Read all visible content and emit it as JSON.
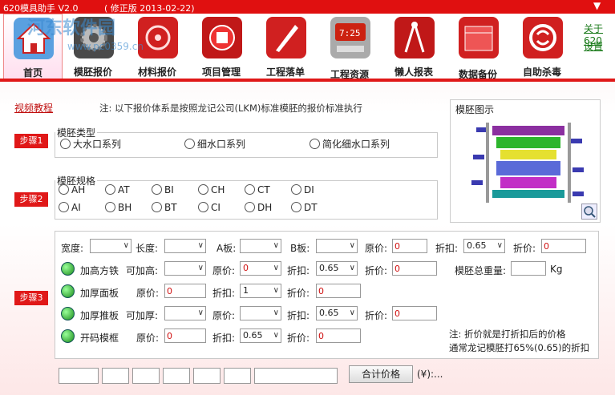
{
  "window": {
    "title": "620模具助手 V2.0",
    "version": "( 修正版 2013-02-22)",
    "menu_arrow": "▼"
  },
  "watermark": {
    "site": "河东软件园",
    "url": "www.pc0359.cn"
  },
  "toolbar": {
    "items": [
      {
        "label": "首页",
        "icon": "home-icon"
      },
      {
        "label": "模胚报价",
        "icon": "gear-icon"
      },
      {
        "label": "材料报价",
        "icon": "material-icon"
      },
      {
        "label": "项目管理",
        "icon": "project-icon"
      },
      {
        "label": "工程落单",
        "icon": "pen-icon"
      },
      {
        "label": "工程资源",
        "icon": "clock-icon"
      },
      {
        "label": "懒人报表",
        "icon": "compass-icon"
      },
      {
        "label": "数据备份",
        "icon": "calendar-icon"
      },
      {
        "label": "自助杀毒",
        "icon": "shield-icon"
      }
    ],
    "about": "关于620",
    "settings": "设置"
  },
  "main": {
    "video_link": "视频教程",
    "note": "注: 以下报价体系是按照龙记公司(LKM)标准模胚的报价标准执行",
    "diagram_title": "模胚图示",
    "step1": "步骤1",
    "step2": "步骤2",
    "step3": "步骤3",
    "type_legend": "模胚类型",
    "types": [
      "大水口系列",
      "细水口系列",
      "简化细水口系列"
    ],
    "spec_legend": "模胚规格",
    "specs": [
      "AH",
      "AT",
      "BI",
      "CH",
      "CT",
      "DI",
      "AI",
      "BH",
      "BT",
      "CI",
      "DH",
      "DT"
    ]
  },
  "form": {
    "width": "宽度:",
    "length": "长度:",
    "a_plate": "A板:",
    "b_plate": "B板:",
    "orig_price": "原价:",
    "discount": "折扣:",
    "disc_price": "折价:",
    "row1": {
      "orig": "0",
      "discount": "0.65",
      "disc": "0"
    },
    "row2": {
      "title": "加高方铁",
      "can": "可加高:",
      "orig": "0",
      "discount": "0.65",
      "disc": "0",
      "total_weight": "模胚总重量:",
      "unit": "Kg"
    },
    "row3": {
      "title": "加厚面板",
      "orig": "0",
      "discount": "1",
      "disc": "0"
    },
    "row4": {
      "title": "加厚推板",
      "can": "可加厚:",
      "discount": "0.65",
      "disc": "0"
    },
    "row5": {
      "title": "开码模框",
      "orig": "0",
      "discount": "0.65",
      "disc": "0"
    },
    "note1": "注: 折价就是打折扣后的价格",
    "note2": "通常龙记模胚打65%(0.65)的折扣"
  },
  "bottom": {
    "calc_button": "合计价格",
    "currency": "(¥):..."
  }
}
